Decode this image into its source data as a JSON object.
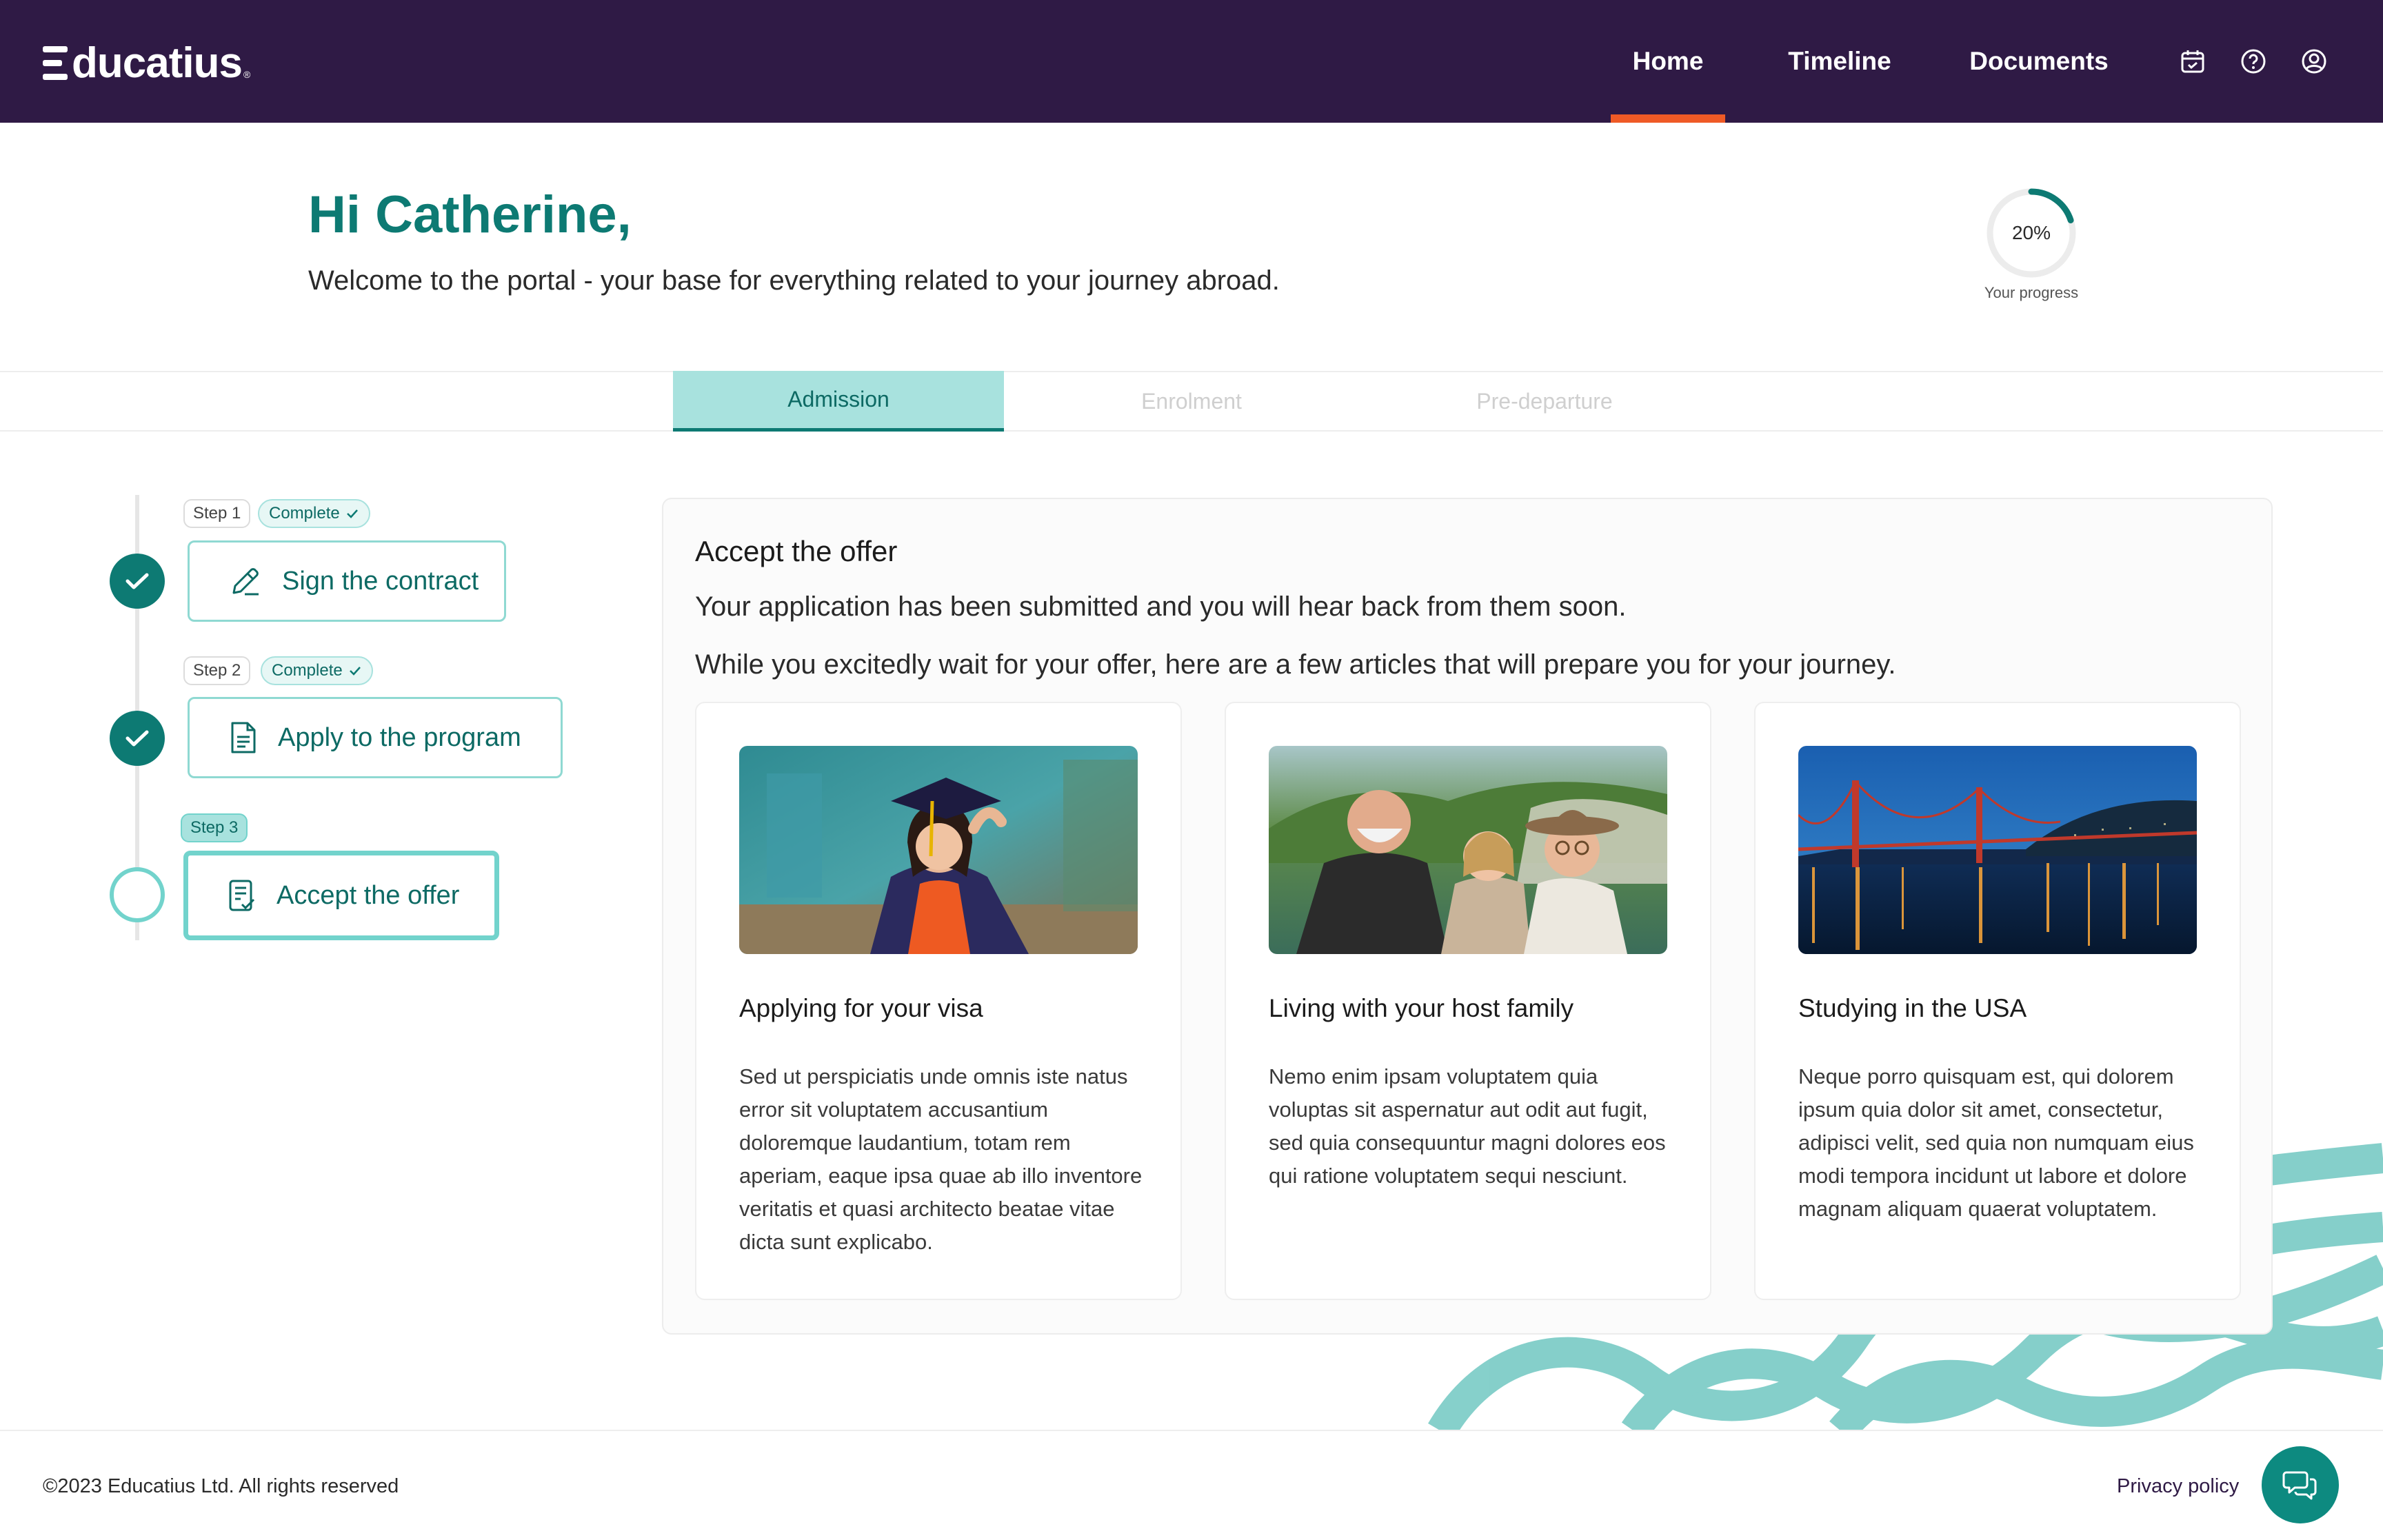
{
  "header": {
    "brand": "Educatius",
    "nav": [
      {
        "label": "Home",
        "active": true
      },
      {
        "label": "Timeline",
        "active": false
      },
      {
        "label": "Documents",
        "active": false
      }
    ],
    "icons": [
      "calendar-icon",
      "help-icon",
      "account-icon"
    ]
  },
  "greeting": {
    "title": "Hi Catherine,",
    "subtitle": "Welcome to the portal - your base for everything related to your journey abroad."
  },
  "progress": {
    "value_label": "20%",
    "value": 0.2,
    "label": "Your progress"
  },
  "tabs": [
    {
      "label": "Admission",
      "active": true
    },
    {
      "label": "Enrolment",
      "active": false
    },
    {
      "label": "Pre-departure",
      "active": false
    }
  ],
  "steps": [
    {
      "step_label": "Step 1",
      "status": "Complete",
      "title": "Sign the contract",
      "icon": "pen-icon",
      "state": "done"
    },
    {
      "step_label": "Step 2",
      "status": "Complete",
      "title": "Apply to the program",
      "icon": "document-icon",
      "state": "done"
    },
    {
      "step_label": "Step 3",
      "status": "",
      "title": "Accept the offer",
      "icon": "offer-document-icon",
      "state": "current"
    }
  ],
  "content": {
    "title": "Accept the offer",
    "paragraph1": "Your application has been submitted and you will hear back from them soon.",
    "paragraph2": "While you excitedly wait for your offer, here are a few articles that will prepare you for your journey.",
    "articles": [
      {
        "title": "Applying for your visa",
        "body": "Sed ut perspiciatis unde omnis iste natus error sit voluptatem accusantium doloremque laudantium, totam rem aperiam, eaque ipsa quae ab illo inventore veritatis et quasi architecto beatae vitae dicta sunt explicabo."
      },
      {
        "title": "Living with your host family",
        "body": "Nemo enim ipsam voluptatem quia voluptas sit aspernatur aut odit aut fugit, sed quia consequuntur magni dolores eos qui ratione voluptatem sequi nesciunt."
      },
      {
        "title": "Studying in the USA",
        "body": "Neque porro quisquam est, qui dolorem ipsum quia dolor sit amet, consectetur, adipisci velit, sed quia non numquam eius modi tempora incidunt ut labore et dolore magnam aliquam quaerat voluptatem."
      }
    ]
  },
  "footer": {
    "copyright": "©2023 Educatius Ltd. All rights reserved",
    "privacy": "Privacy policy"
  },
  "colors": {
    "header_bg": "#2f1a45",
    "accent": "#ef5a26",
    "teal": "#0d7a73",
    "teal_light": "#a8e2de"
  }
}
